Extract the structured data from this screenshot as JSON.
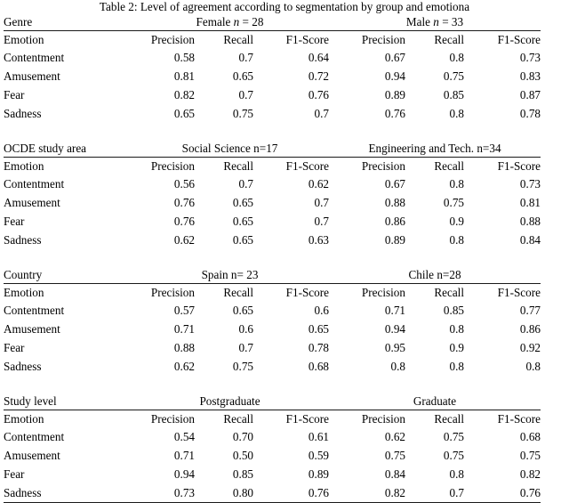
{
  "caption": {
    "text": "Table 2: Level of agreement according to segmentation by group and emotiona"
  },
  "table": {
    "column_headers": [
      "Emotion",
      "Precision",
      "Recall",
      "F1-Score",
      "Precision",
      "Recall",
      "F1-Score"
    ],
    "blocks": [
      {
        "dimension_label": "Genre",
        "group_left": "Female n = 28",
        "group_left_prefix": "Female",
        "group_left_italic": "n",
        "group_left_suffix": "= 28",
        "group_right": "Male n = 33",
        "group_right_prefix": "Male",
        "group_right_italic": "n",
        "group_right_suffix": "= 33",
        "rows": [
          {
            "emotion": "Contentment",
            "bold": false,
            "values": [
              "0.58",
              "0.7",
              "0.64",
              "0.67",
              "0.8",
              "0.73"
            ],
            "bold_values": [
              false,
              false,
              false,
              false,
              false,
              false
            ]
          },
          {
            "emotion": "Amusement",
            "bold": false,
            "values": [
              "0.81",
              "0.65",
              "0.72",
              "0.94",
              "0.75",
              "0.83"
            ],
            "bold_values": [
              false,
              false,
              false,
              false,
              false,
              false
            ]
          },
          {
            "emotion": "Fear",
            "bold": true,
            "values": [
              "0.82",
              "0.7",
              "0.76",
              "0.89",
              "0.85",
              "0.87"
            ],
            "bold_values": [
              true,
              true,
              true,
              true,
              true,
              true
            ]
          },
          {
            "emotion": "Sadness",
            "bold": false,
            "values": [
              "0.65",
              "0.75",
              "0.7",
              "0.76",
              "0.8",
              "0.78"
            ],
            "bold_values": [
              false,
              false,
              false,
              false,
              false,
              false
            ]
          }
        ]
      },
      {
        "dimension_label": "OCDE study area",
        "group_left": "Social Science n=17",
        "group_right": "Engineering and Tech. n=34",
        "rows": [
          {
            "emotion": "Contentment",
            "bold": false,
            "values": [
              "0.56",
              "0.7",
              "0.62",
              "0.67",
              "0.8",
              "0.73"
            ],
            "bold_values": [
              false,
              false,
              false,
              false,
              false,
              false
            ]
          },
          {
            "emotion": "Amusement",
            "bold": false,
            "values": [
              "0.76",
              "0.65",
              "0.7",
              "0.88",
              "0.75",
              "0.81"
            ],
            "bold_values": [
              true,
              true,
              true,
              false,
              false,
              false
            ]
          },
          {
            "emotion": "Fear",
            "bold": true,
            "values": [
              "0.76",
              "0.65",
              "0.7",
              "0.86",
              "0.9",
              "0.88"
            ],
            "bold_values": [
              true,
              true,
              true,
              true,
              true,
              true
            ]
          },
          {
            "emotion": "Sadness",
            "bold": false,
            "values": [
              "0.62",
              "0.65",
              "0.63",
              "0.89",
              "0.8",
              "0.84"
            ],
            "bold_values": [
              false,
              false,
              false,
              false,
              false,
              false
            ]
          }
        ]
      },
      {
        "dimension_label": "Country",
        "group_left": "Spain n= 23",
        "group_right": "Chile n=28",
        "rows": [
          {
            "emotion": "Contentment",
            "bold": false,
            "values": [
              "0.57",
              "0.65",
              "0.6",
              "0.71",
              "0.85",
              "0.77"
            ],
            "bold_values": [
              false,
              false,
              false,
              false,
              false,
              false
            ]
          },
          {
            "emotion": "Amusement",
            "bold": false,
            "values": [
              "0.71",
              "0.6",
              "0.65",
              "0.94",
              "0.8",
              "0.86"
            ],
            "bold_values": [
              false,
              false,
              false,
              false,
              false,
              false
            ]
          },
          {
            "emotion": "Fear",
            "bold": true,
            "values": [
              "0.88",
              "0.7",
              "0.78",
              "0.95",
              "0.9",
              "0.92"
            ],
            "bold_values": [
              true,
              true,
              true,
              true,
              true,
              true
            ]
          },
          {
            "emotion": "Sadness",
            "bold": false,
            "values": [
              "0.62",
              "0.75",
              "0.68",
              "0.8",
              "0.8",
              "0.8"
            ],
            "bold_values": [
              false,
              false,
              false,
              false,
              false,
              false
            ]
          }
        ]
      },
      {
        "dimension_label": "Study level",
        "group_left": "Postgraduate",
        "group_right": "Graduate",
        "rows": [
          {
            "emotion": "Contentment",
            "bold": false,
            "values": [
              "0.54",
              "0.70",
              "0.61",
              "0.62",
              "0.75",
              "0.68"
            ],
            "bold_values": [
              false,
              false,
              false,
              false,
              false,
              false
            ]
          },
          {
            "emotion": "Amusement",
            "bold": false,
            "values": [
              "0.71",
              "0.50",
              "0.59",
              "0.75",
              "0.75",
              "0.75"
            ],
            "bold_values": [
              false,
              false,
              false,
              false,
              false,
              false
            ]
          },
          {
            "emotion": "Fear",
            "bold": true,
            "values": [
              "0.94",
              "0.85",
              "0.89",
              "0.84",
              "0.8",
              "0.82"
            ],
            "bold_values": [
              true,
              true,
              true,
              true,
              true,
              true
            ]
          },
          {
            "emotion": "Sadness",
            "bold": false,
            "values": [
              "0.73",
              "0.80",
              "0.76",
              "0.82",
              "0.7",
              "0.76"
            ],
            "bold_values": [
              false,
              false,
              false,
              false,
              false,
              false
            ]
          }
        ]
      }
    ]
  }
}
